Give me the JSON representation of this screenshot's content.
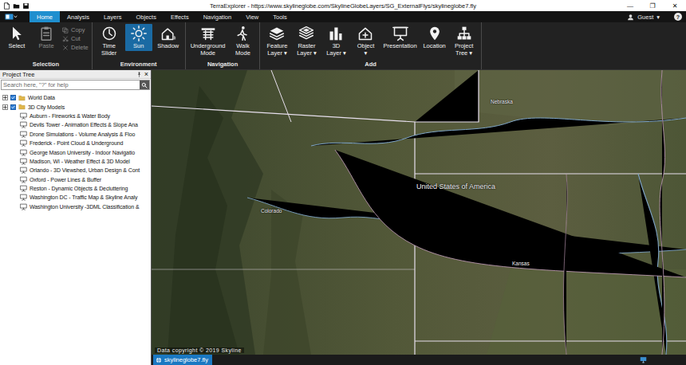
{
  "window": {
    "title": "TerraExplorer - https://www.skylineglobe.com/SkylineGlobeLayers/SG_ExternalFlys/skylineglobe7.fly",
    "controls": [
      "—",
      "❐",
      "✕"
    ]
  },
  "menu_tabs": [
    {
      "label": "Home",
      "selected": true
    },
    {
      "label": "Analysis",
      "selected": false
    },
    {
      "label": "Layers",
      "selected": false
    },
    {
      "label": "Objects",
      "selected": false
    },
    {
      "label": "Effects",
      "selected": false
    },
    {
      "label": "Navigation",
      "selected": false
    },
    {
      "label": "View",
      "selected": false
    },
    {
      "label": "Tools",
      "selected": false
    }
  ],
  "account": {
    "user": "Guest",
    "caret": "▾",
    "help": "?"
  },
  "ribbon": {
    "groups": [
      {
        "label": "Selection",
        "items": [
          {
            "kind": "large",
            "lines": [
              "Select"
            ],
            "disabled": false,
            "selected": false
          },
          {
            "kind": "large",
            "lines": [
              "Paste"
            ],
            "disabled": true,
            "selected": false
          },
          {
            "kind": "small",
            "lines": [
              "Copy"
            ],
            "disabled": true,
            "selected": false
          },
          {
            "kind": "small",
            "lines": [
              "Cut"
            ],
            "disabled": true,
            "selected": false
          },
          {
            "kind": "small",
            "lines": [
              "Delete"
            ],
            "disabled": true,
            "selected": false
          }
        ]
      },
      {
        "label": "Environment",
        "items": [
          {
            "kind": "large",
            "lines": [
              "Time",
              "Slider"
            ],
            "disabled": false,
            "selected": false
          },
          {
            "kind": "large",
            "lines": [
              "Sun"
            ],
            "disabled": false,
            "selected": true
          },
          {
            "kind": "large",
            "lines": [
              "Shadow"
            ],
            "disabled": false,
            "selected": false
          }
        ]
      },
      {
        "label": "Navigation",
        "items": [
          {
            "kind": "large",
            "lines": [
              "Underground",
              "Mode"
            ],
            "disabled": false,
            "selected": false
          },
          {
            "kind": "large",
            "lines": [
              "Walk",
              "Mode"
            ],
            "disabled": false,
            "selected": false
          }
        ]
      },
      {
        "label": "Add",
        "items": [
          {
            "kind": "large",
            "lines": [
              "Feature",
              "Layer ▾"
            ],
            "disabled": false,
            "selected": false
          },
          {
            "kind": "large",
            "lines": [
              "Raster",
              "Layer ▾"
            ],
            "disabled": false,
            "selected": false
          },
          {
            "kind": "large",
            "lines": [
              "3D",
              "Layer ▾"
            ],
            "disabled": false,
            "selected": false
          },
          {
            "kind": "large",
            "lines": [
              "Object",
              "▾"
            ],
            "disabled": false,
            "selected": false
          },
          {
            "kind": "large",
            "lines": [
              "Presentation"
            ],
            "disabled": false,
            "selected": false
          },
          {
            "kind": "large",
            "lines": [
              "Location"
            ],
            "disabled": false,
            "selected": false
          },
          {
            "kind": "large",
            "lines": [
              "Project",
              "Tree ▾"
            ],
            "disabled": false,
            "selected": false
          }
        ]
      }
    ]
  },
  "project_tree": {
    "title": "Project Tree",
    "close": "×",
    "search": {
      "placeholder": "Search here, \"?\" for help"
    },
    "items": [
      {
        "kind": "folder",
        "label": "World Data",
        "expanded": false,
        "checked": true
      },
      {
        "kind": "folder",
        "label": "3D City Models",
        "expanded": false,
        "checked": true
      },
      {
        "kind": "presentation",
        "label": "Auburn - Fireworks & Water Body"
      },
      {
        "kind": "presentation",
        "label": "Devils Tower - Animation Effects & Slope Ana"
      },
      {
        "kind": "presentation",
        "label": "Drone Simulations - Volume Analysis & Floo"
      },
      {
        "kind": "presentation",
        "label": "Frederick - Point Cloud & Underground"
      },
      {
        "kind": "presentation",
        "label": "George Mason University - Indoor Navigatio"
      },
      {
        "kind": "presentation",
        "label": "Madison, WI - Weather Effect & 3D Model"
      },
      {
        "kind": "presentation",
        "label": "Orlando - 3D Viewshed, Urban Design & Cont"
      },
      {
        "kind": "presentation",
        "label": "Oxford - Power Lines & Buffer"
      },
      {
        "kind": "presentation",
        "label": "Reston - Dynamic Objects & Decluttering"
      },
      {
        "kind": "presentation",
        "label": "Washington DC - Traffic Map & Skyline Analy"
      },
      {
        "kind": "presentation",
        "label": "Washington University -3DML Classification &"
      }
    ]
  },
  "map": {
    "labels": [
      {
        "text": "Nebraska",
        "kind": "state"
      },
      {
        "text": "United States of America",
        "kind": "country"
      },
      {
        "text": "Colorado",
        "kind": "state"
      },
      {
        "text": "Kansas",
        "kind": "state"
      }
    ],
    "copyright": "Data copyright © 2019 Skyline"
  },
  "status_bar": {
    "tabs": [
      {
        "label": "skylineglobe7.fly",
        "selected": true
      }
    ]
  }
}
